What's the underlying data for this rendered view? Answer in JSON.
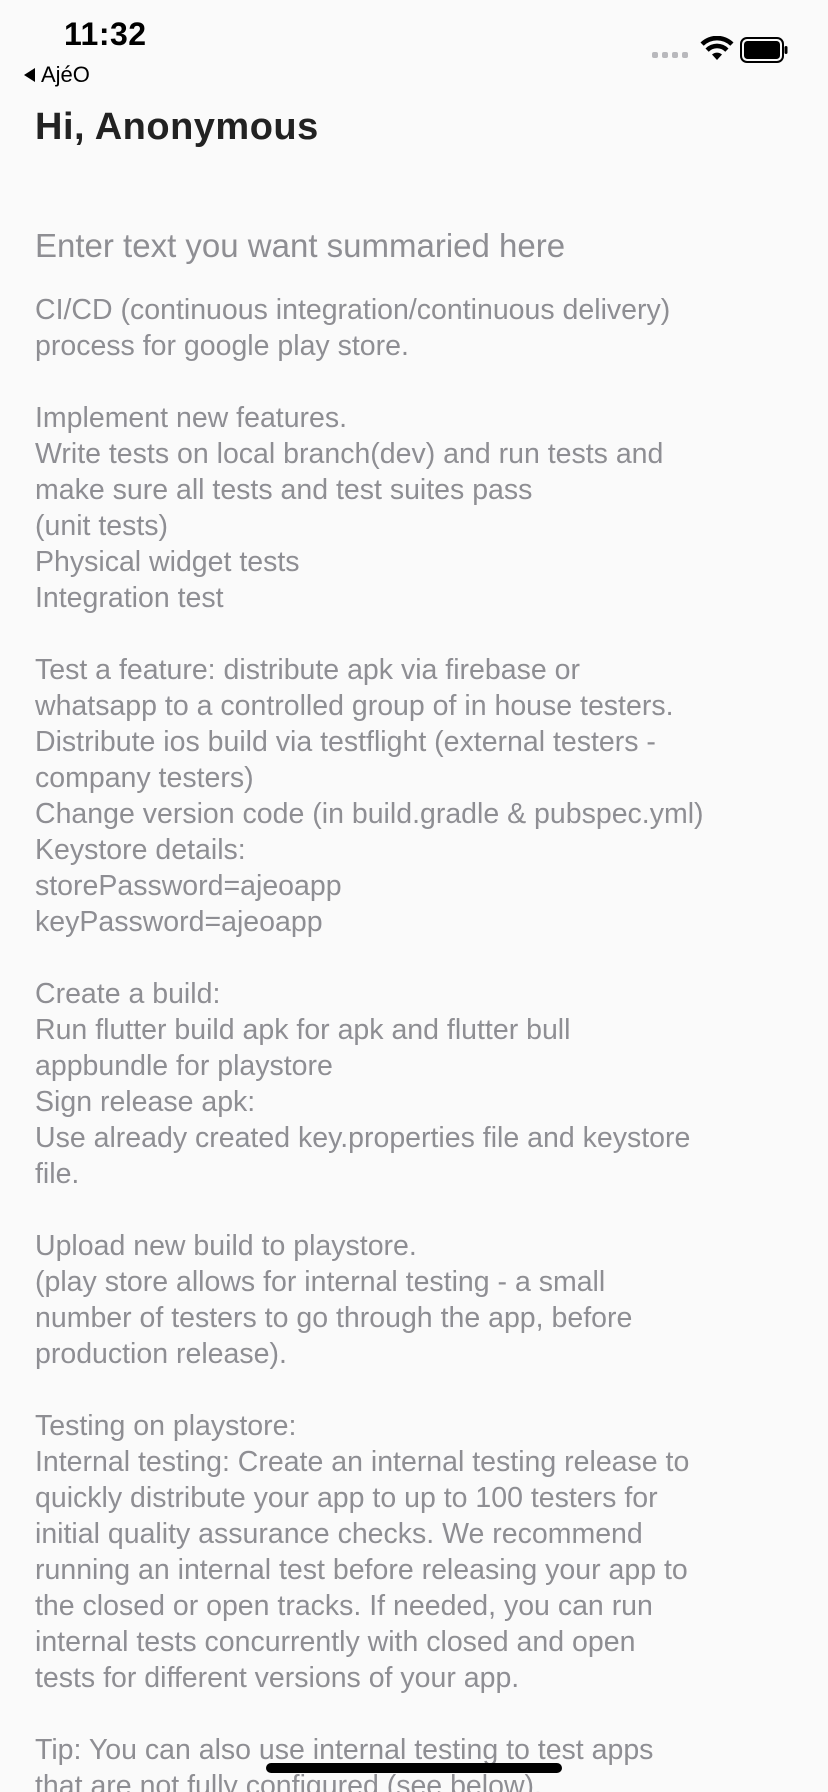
{
  "status_bar": {
    "time": "11:32",
    "signal_icon": "cellular-signal-icon",
    "wifi_icon": "wifi-icon",
    "battery_icon": "battery-icon"
  },
  "nav": {
    "back_label": "AjéO",
    "back_icon": "back-triangle-icon"
  },
  "header": {
    "greeting": "Hi, Anonymous"
  },
  "input": {
    "placeholder": "Enter text you want summaried here",
    "value": "CI/CD (continuous integration/continuous delivery)\nprocess for google play store.\n\nImplement new features.\nWrite tests on local branch(dev) and run tests and\nmake sure all tests and test suites pass\n(unit tests)\nPhysical widget tests\nIntegration test\n\nTest a feature: distribute apk via firebase or\nwhatsapp to a controlled group of in house testers.\nDistribute ios build via testflight (external testers -\ncompany testers)\nChange version code (in build.gradle & pubspec.yml)\nKeystore details:\nstorePassword=ajeoapp\nkeyPassword=ajeoapp\n\nCreate a build:\nRun flutter build apk for apk and flutter bull\nappbundle for playstore\nSign release apk:\nUse already created key.properties file and keystore\nfile.\n\nUpload new build to playstore.\n(play store allows for internal testing - a small\nnumber of testers to go through the app, before\nproduction release).\n\nTesting on playstore:\nInternal testing: Create an internal testing release to\nquickly distribute your app to up to 100 testers for\ninitial quality assurance checks. We recommend\nrunning an internal test before releasing your app to\nthe closed or open tracks. If needed, you can run\ninternal tests concurrently with closed and open\ntests for different versions of your app.\n\nTip: You can also use internal testing to test apps\nthat are not fully configured (see below)."
  }
}
